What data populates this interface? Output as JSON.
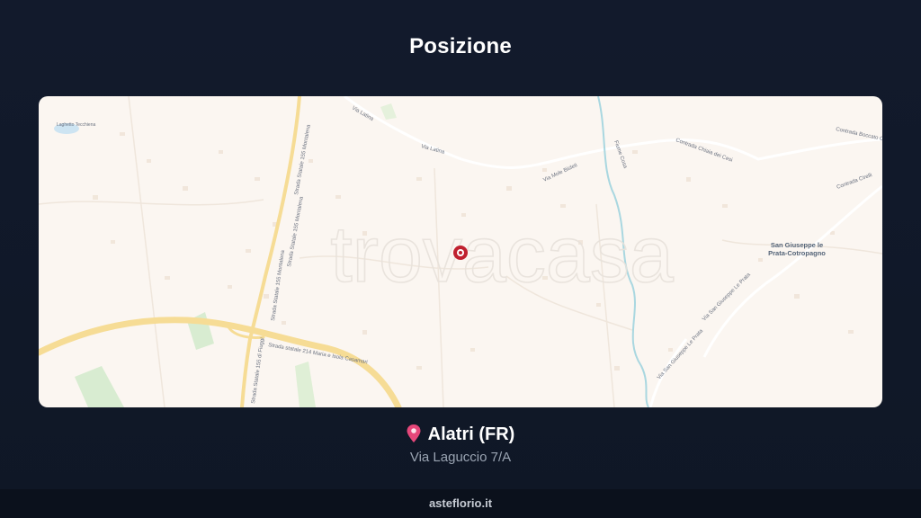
{
  "header": {
    "title": "Posizione"
  },
  "map": {
    "watermark": "trovacasa",
    "labels": {
      "via_latina_1": "Via Latina",
      "via_latina_2": "Via Latina",
      "via_mole_bisleti": "Via Mole Bisleti",
      "strada_155_a": "Strada Statale 155 Montalena",
      "strada_155_b": "Strada Statale 155 Montalena",
      "strada_155_c": "Strada Statale 155 Montalena",
      "strada_214": "Strada statale 214 Maria e Isola Casamari",
      "strada_155_fiuggi": "Strada Statale 155 di Fiuggi",
      "contrada_cirelli": "Contrada Cirelli",
      "contrada_bosco": "Contrada Boccato Ceraso",
      "contrada_chiaia": "Contrada Chiaia dei Cesi",
      "via_san_giuseppe_1": "Via San Giuseppe Le Prata",
      "via_san_giuseppe_2": "Via San Giuseppe Le Prata",
      "fiume": "Fiume Cosa",
      "lago": "Laghetto Tecchiena",
      "village_line1": "San Giuseppe le",
      "village_line2": "Prata-Cotropagno"
    },
    "marker_icon": "location-marker-icon"
  },
  "location": {
    "pin_icon": "map-pin-icon",
    "city": "Alatri (FR)",
    "address": "Via Laguccio 7/A"
  },
  "footer": {
    "site": "asteflorio.it"
  }
}
